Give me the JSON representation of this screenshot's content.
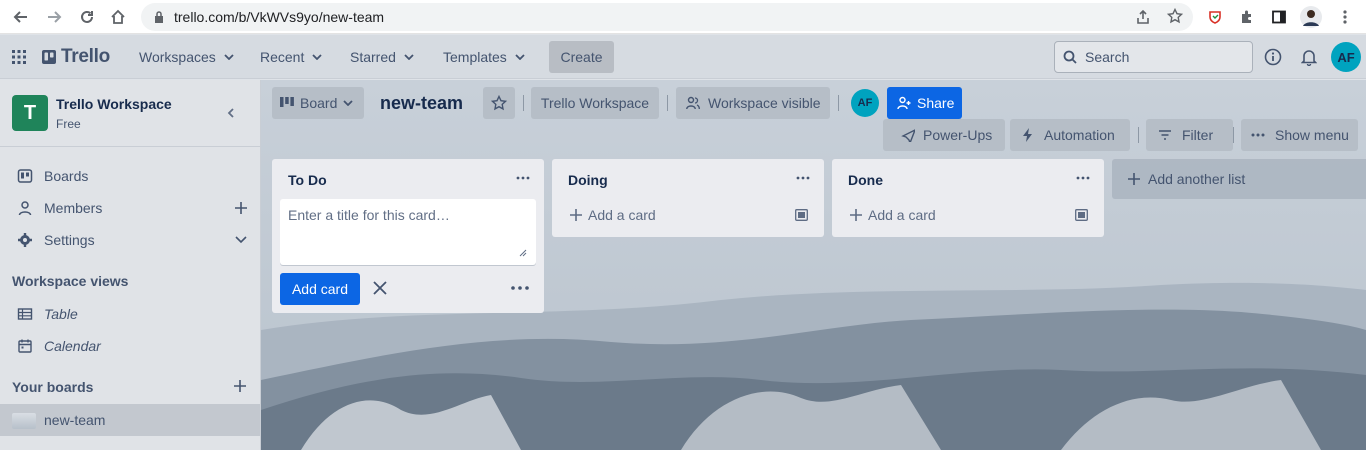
{
  "browser": {
    "url": "trello.com/b/VkWVs9yo/new-team"
  },
  "header": {
    "logo": "Trello",
    "nav": [
      "Workspaces",
      "Recent",
      "Starred",
      "Templates"
    ],
    "create": "Create",
    "search_placeholder": "Search",
    "avatar": "AF"
  },
  "sidebar": {
    "workspace_initial": "T",
    "workspace_name": "Trello Workspace",
    "workspace_plan": "Free",
    "items": [
      {
        "label": "Boards"
      },
      {
        "label": "Members"
      },
      {
        "label": "Settings"
      }
    ],
    "views_heading": "Workspace views",
    "views": [
      {
        "label": "Table"
      },
      {
        "label": "Calendar"
      }
    ],
    "your_boards_heading": "Your boards",
    "boards": [
      {
        "label": "new-team"
      }
    ]
  },
  "board": {
    "view": "Board",
    "name": "new-team",
    "workspace": "Trello Workspace",
    "visibility": "Workspace visible",
    "member_avatar": "AF",
    "share": "Share",
    "power_ups": "Power-Ups",
    "automation": "Automation",
    "filter": "Filter",
    "show_menu": "Show menu",
    "lists": [
      {
        "title": "To Do",
        "composer_placeholder": "Enter a title for this card…",
        "add_button": "Add card"
      },
      {
        "title": "Doing",
        "add_card": "Add a card"
      },
      {
        "title": "Done",
        "add_card": "Add a card"
      }
    ],
    "add_list": "Add another list"
  },
  "colors": {
    "accent": "#0079bf",
    "avatar": "#00a3bf",
    "workspace_tile": "#1f845a"
  }
}
